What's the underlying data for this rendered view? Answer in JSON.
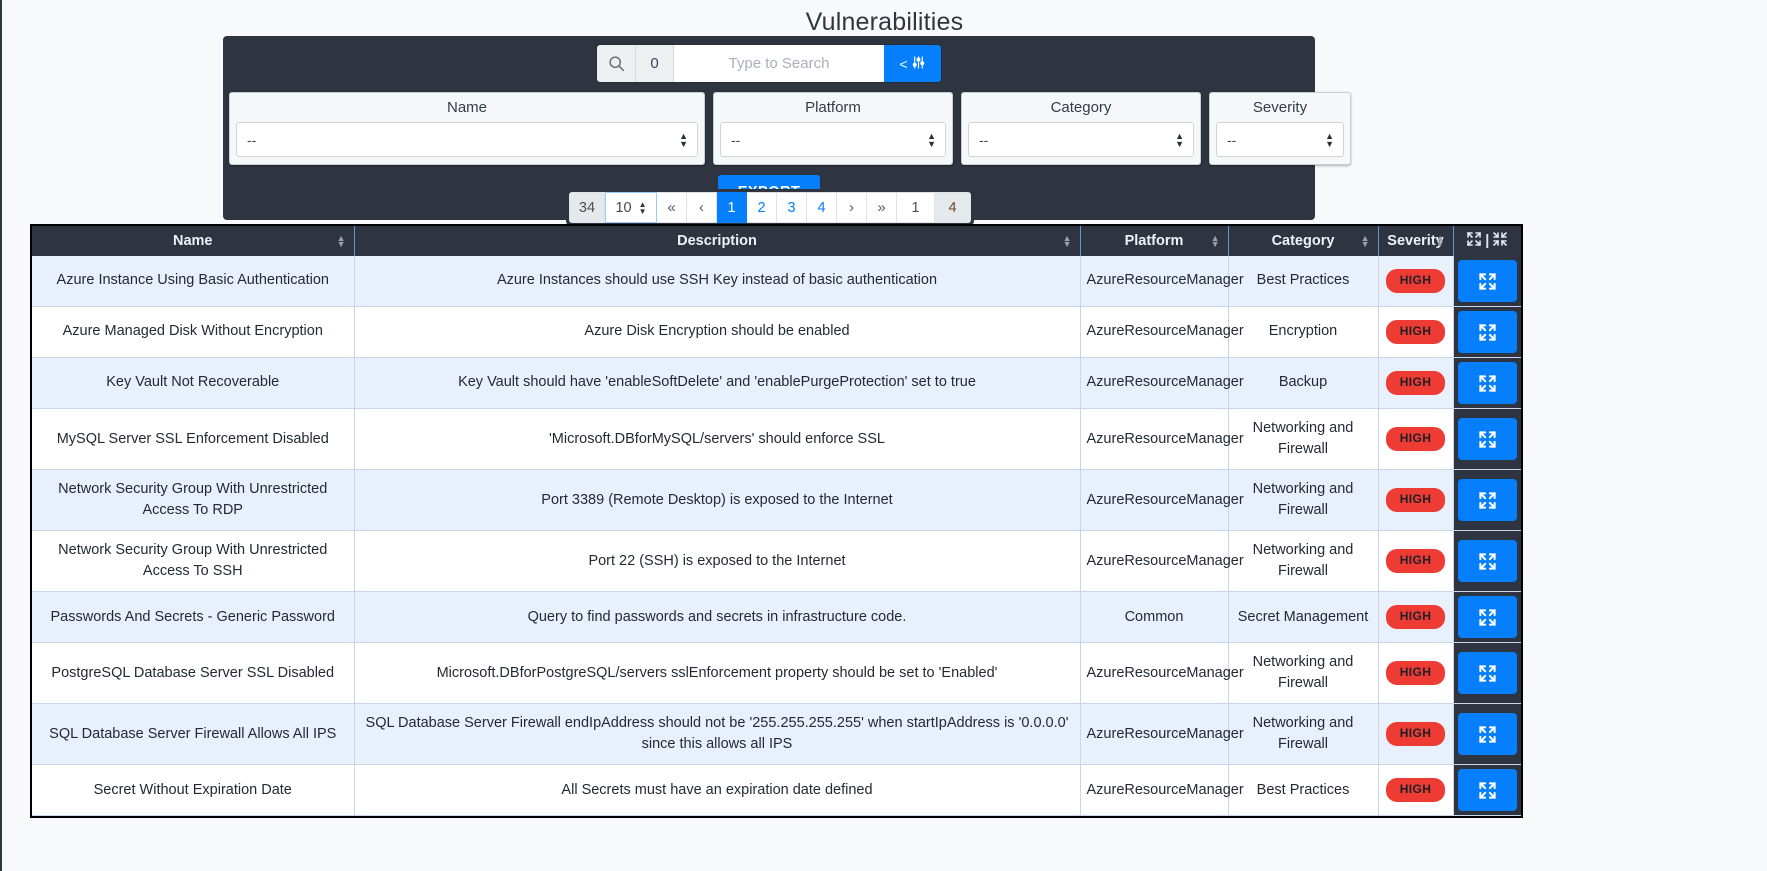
{
  "header": {
    "title": "Vulnerabilities"
  },
  "search": {
    "icon": "search-icon",
    "count": "0",
    "placeholder": "Type to Search",
    "value": "",
    "advanced_label": "<",
    "advanced_icon": "sliders-icon"
  },
  "filters": [
    {
      "label": "Name",
      "value": "--"
    },
    {
      "label": "Platform",
      "value": "--"
    },
    {
      "label": "Category",
      "value": "--"
    },
    {
      "label": "Severity",
      "value": "--"
    }
  ],
  "export": {
    "label": "EXPORT"
  },
  "pagination": {
    "total": "34",
    "per_page": "10",
    "first": "«",
    "prev": "‹",
    "pages": [
      "1",
      "2",
      "3",
      "4"
    ],
    "active_page": "1",
    "next": "›",
    "last": "»",
    "current_page_input": "1",
    "page_count": "4"
  },
  "table": {
    "columns": [
      {
        "label": "Name",
        "sortable": true
      },
      {
        "label": "Description",
        "sortable": true
      },
      {
        "label": "Platform",
        "sortable": true
      },
      {
        "label": "Category",
        "sortable": true
      },
      {
        "label": "Severity",
        "sortable": true
      },
      {
        "label": "",
        "sortable": false
      }
    ],
    "rows": [
      {
        "name": "Azure Instance Using Basic Authentication",
        "description": "Azure Instances should use SSH Key instead of basic authentication",
        "platform": "AzureResourceManager",
        "category": "Best Practices",
        "severity": "HIGH"
      },
      {
        "name": "Azure Managed Disk Without Encryption",
        "description": "Azure Disk Encryption should be enabled",
        "platform": "AzureResourceManager",
        "category": "Encryption",
        "severity": "HIGH"
      },
      {
        "name": "Key Vault Not Recoverable",
        "description": "Key Vault should have 'enableSoftDelete' and 'enablePurgeProtection' set to true",
        "platform": "AzureResourceManager",
        "category": "Backup",
        "severity": "HIGH"
      },
      {
        "name": "MySQL Server SSL Enforcement Disabled",
        "description": "'Microsoft.DBforMySQL/servers' should enforce SSL",
        "platform": "AzureResourceManager",
        "category": "Networking and Firewall",
        "severity": "HIGH"
      },
      {
        "name": "Network Security Group With Unrestricted Access To RDP",
        "description": "Port 3389 (Remote Desktop) is exposed to the Internet",
        "platform": "AzureResourceManager",
        "category": "Networking and Firewall",
        "severity": "HIGH"
      },
      {
        "name": "Network Security Group With Unrestricted Access To SSH",
        "description": "Port 22 (SSH) is exposed to the Internet",
        "platform": "AzureResourceManager",
        "category": "Networking and Firewall",
        "severity": "HIGH"
      },
      {
        "name": "Passwords And Secrets - Generic Password",
        "description": "Query to find passwords and secrets in infrastructure code.",
        "platform": "Common",
        "category": "Secret Management",
        "severity": "HIGH"
      },
      {
        "name": "PostgreSQL Database Server SSL Disabled",
        "description": "Microsoft.DBforPostgreSQL/servers sslEnforcement property should be set to 'Enabled'",
        "platform": "AzureResourceManager",
        "category": "Networking and Firewall",
        "severity": "HIGH"
      },
      {
        "name": "SQL Database Server Firewall Allows All IPS",
        "description": "SQL Database Server Firewall endIpAddress should not be '255.255.255.255' when startIpAddress is '0.0.0.0' since this allows all IPS",
        "platform": "AzureResourceManager",
        "category": "Networking and Firewall",
        "severity": "HIGH"
      },
      {
        "name": "Secret Without Expiration Date",
        "description": "All Secrets must have an expiration date defined",
        "platform": "AzureResourceManager",
        "category": "Best Practices",
        "severity": "HIGH"
      }
    ]
  },
  "colors": {
    "accent": "#057ffb",
    "panel": "#2e3440",
    "severity_high": "#ee3b33",
    "row_alt": "#e8f0fb"
  }
}
